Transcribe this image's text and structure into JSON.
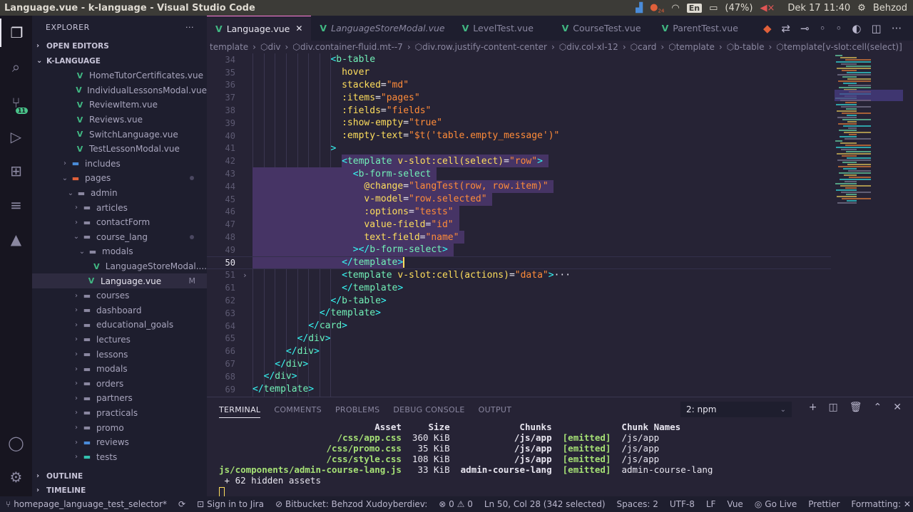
{
  "os": {
    "window_title": "Language.vue - k-language - Visual Studio Code",
    "badge_count": "24",
    "keyboard": "En",
    "battery": "(47%)",
    "datetime": "Dek 17 11:40",
    "user": "Behzod"
  },
  "activity": {
    "scm_badge": "11"
  },
  "sidebar": {
    "title": "EXPLORER",
    "more": "···",
    "open_editors": "OPEN EDITORS",
    "project": "K-LANGUAGE",
    "outline": "OUTLINE",
    "timeline": "TIMELINE",
    "items": [
      {
        "label": "HomeTutorCertificates.vue",
        "type": "vue",
        "indent": 1
      },
      {
        "label": "IndividualLessonsModal.vue",
        "type": "vue",
        "indent": 1
      },
      {
        "label": "ReviewItem.vue",
        "type": "vue",
        "indent": 1
      },
      {
        "label": "Reviews.vue",
        "type": "vue",
        "indent": 1
      },
      {
        "label": "SwitchLanguage.vue",
        "type": "vue",
        "indent": 1
      },
      {
        "label": "TestLessonModal.vue",
        "type": "vue",
        "indent": 1
      },
      {
        "label": "includes",
        "type": "folder-blue",
        "indent": 0
      },
      {
        "label": "pages",
        "type": "folder-red-open",
        "indent": 0
      },
      {
        "label": "admin",
        "type": "folder-open",
        "indent": 1
      },
      {
        "label": "articles",
        "type": "folder",
        "indent": 2
      },
      {
        "label": "contactForm",
        "type": "folder",
        "indent": 2
      },
      {
        "label": "course_lang",
        "type": "folder-open",
        "indent": 2
      },
      {
        "label": "modals",
        "type": "folder-open",
        "indent": 3
      },
      {
        "label": "LanguageStoreModal....",
        "type": "vue",
        "indent": 4
      },
      {
        "label": "Language.vue",
        "type": "vue-sel",
        "indent": 3
      },
      {
        "label": "courses",
        "type": "folder",
        "indent": 2
      },
      {
        "label": "dashboard",
        "type": "folder",
        "indent": 2
      },
      {
        "label": "educational_goals",
        "type": "folder",
        "indent": 2
      },
      {
        "label": "lectures",
        "type": "folder",
        "indent": 2
      },
      {
        "label": "lessons",
        "type": "folder",
        "indent": 2
      },
      {
        "label": "modals",
        "type": "folder",
        "indent": 2
      },
      {
        "label": "orders",
        "type": "folder",
        "indent": 2
      },
      {
        "label": "partners",
        "type": "folder",
        "indent": 2
      },
      {
        "label": "practicals",
        "type": "folder",
        "indent": 2
      },
      {
        "label": "promo",
        "type": "folder",
        "indent": 2
      },
      {
        "label": "reviews",
        "type": "folder-blue",
        "indent": 2
      },
      {
        "label": "tests",
        "type": "folder-teal",
        "indent": 2
      }
    ],
    "modified_mark": "M"
  },
  "tabs": [
    {
      "label": "Language.vue",
      "active": true
    },
    {
      "label": "LanguageStoreModal.vue",
      "italic": true
    },
    {
      "label": "LevelTest.vue"
    },
    {
      "label": "CourseTest.vue"
    },
    {
      "label": "ParentTest.vue"
    }
  ],
  "breadcrumbs": [
    "template",
    "div",
    "div.container-fluid.mt--7",
    "div.row.justify-content-center",
    "div.col-xl-12",
    "card",
    "template",
    "b-table",
    "template[v-slot:cell(select)]"
  ],
  "editor": {
    "lines": [
      {
        "n": "34",
        "indent": 7,
        "html": "<span class='t-ang'>&lt;</span><span class='t-tag'>b-table</span>"
      },
      {
        "n": "35",
        "indent": 8,
        "text": "hover"
      },
      {
        "n": "36",
        "indent": 8,
        "html": "stacked<span class='t-punc'>=</span><span class='t-str'>\"md\"</span>"
      },
      {
        "n": "37",
        "indent": 8,
        "html": ":items<span class='t-punc'>=</span><span class='t-str'>\"pages\"</span>"
      },
      {
        "n": "38",
        "indent": 8,
        "html": ":fields<span class='t-punc'>=</span><span class='t-str'>\"fields\"</span>"
      },
      {
        "n": "39",
        "indent": 8,
        "html": ":show-empty<span class='t-punc'>=</span><span class='t-str'>\"true\"</span>"
      },
      {
        "n": "40",
        "indent": 8,
        "html": ":empty-text<span class='t-punc'>=</span><span class='t-str'>\"$t('table.empty_message')\"</span>"
      },
      {
        "n": "41",
        "indent": 7,
        "html": "<span class='t-ang'>&gt;</span>"
      },
      {
        "n": "42",
        "indent": 8,
        "html": "<span class='t-ang'>&lt;</span><span class='t-tag'>template</span> v-slot:cell(select)<span class='t-punc'>=</span><span class='t-str'>\"row\"</span><span class='t-ang'>&gt;</span>"
      },
      {
        "n": "43",
        "indent": 9,
        "html": "<span class='t-ang'>&lt;</span><span class='t-tag'>b-form-select</span>"
      },
      {
        "n": "44",
        "indent": 10,
        "html": "@change<span class='t-punc'>=</span><span class='t-str'>\"langTest(row, row.item)\"</span>"
      },
      {
        "n": "45",
        "indent": 10,
        "html": "v-model<span class='t-punc'>=</span><span class='t-str'>\"row.selected\"</span>"
      },
      {
        "n": "46",
        "indent": 10,
        "html": ":options<span class='t-punc'>=</span><span class='t-str'>\"tests\"</span>"
      },
      {
        "n": "47",
        "indent": 10,
        "html": "value-field<span class='t-punc'>=</span><span class='t-str'>\"id\"</span>"
      },
      {
        "n": "48",
        "indent": 10,
        "html": "text-field<span class='t-punc'>=</span><span class='t-str'>\"name\"</span>"
      },
      {
        "n": "49",
        "indent": 9,
        "html": "<span class='t-ang'>&gt;&lt;/</span><span class='t-tag'>b-form-select</span><span class='t-ang'>&gt;</span>"
      },
      {
        "n": "50",
        "indent": 8,
        "html": "<span class='t-ang'>&lt;/</span><span class='t-tag'>template</span><span class='t-ang'>&gt;</span>",
        "current": true
      },
      {
        "n": "51",
        "indent": 8,
        "html": "<span class='t-ang'>&lt;</span><span class='t-tag'>template</span> v-slot:cell(actions)<span class='t-punc'>=</span><span class='t-str'>\"data\"</span><span class='t-ang'>&gt;</span><span class='t-punc'>···</span>",
        "folded": true
      },
      {
        "n": "61",
        "indent": 8,
        "html": "<span class='t-ang'>&lt;/</span><span class='t-tag'>template</span><span class='t-ang'>&gt;</span>"
      },
      {
        "n": "62",
        "indent": 7,
        "html": "<span class='t-ang'>&lt;/</span><span class='t-tag'>b-table</span><span class='t-ang'>&gt;</span>"
      },
      {
        "n": "63",
        "indent": 6,
        "html": "<span class='t-ang'>&lt;/</span><span class='t-tag'>template</span><span class='t-ang'>&gt;</span>"
      },
      {
        "n": "64",
        "indent": 5,
        "html": "<span class='t-ang'>&lt;/</span><span class='t-tag'>card</span><span class='t-ang'>&gt;</span>"
      },
      {
        "n": "65",
        "indent": 4,
        "html": "<span class='t-ang'>&lt;/</span><span class='t-tag'>div</span><span class='t-ang'>&gt;</span>"
      },
      {
        "n": "66",
        "indent": 3,
        "html": "<span class='t-ang'>&lt;/</span><span class='t-tag'>div</span><span class='t-ang'>&gt;</span>"
      },
      {
        "n": "67",
        "indent": 2,
        "html": "<span class='t-ang'>&lt;/</span><span class='t-tag'>div</span><span class='t-ang'>&gt;</span>"
      },
      {
        "n": "68",
        "indent": 1,
        "html": "<span class='t-ang'>&lt;/</span><span class='t-tag'>div</span><span class='t-ang'>&gt;</span>"
      },
      {
        "n": "69",
        "indent": 0,
        "html": "<span class='t-ang'>&lt;/</span><span class='t-tag'>template</span><span class='t-ang'>&gt;</span>"
      }
    ]
  },
  "panel": {
    "tabs": [
      "TERMINAL",
      "COMMENTS",
      "PROBLEMS",
      "DEBUG CONSOLE",
      "OUTPUT"
    ],
    "terminal_select": "2: npm",
    "header": {
      "asset": "Asset",
      "size": "Size",
      "chunks": "Chunks",
      "names": "Chunk Names"
    },
    "rows": [
      {
        "asset": "/css/app.css",
        "size": "360 KiB",
        "chunk": "/js/app",
        "status": "[emitted]",
        "name": "/js/app"
      },
      {
        "asset": "/css/promo.css",
        "size": "35 KiB",
        "chunk": "/js/app",
        "status": "[emitted]",
        "name": "/js/app"
      },
      {
        "asset": "/css/style.css",
        "size": "108 KiB",
        "chunk": "/js/app",
        "status": "[emitted]",
        "name": "/js/app"
      },
      {
        "asset": "js/components/admin-course-lang.js",
        "size": "33 KiB",
        "chunk": "admin-course-lang",
        "status": "[emitted]",
        "name": "admin-course-lang"
      }
    ],
    "hidden": " + 62 hidden assets"
  },
  "status": {
    "branch": "homepage_language_test_selector*",
    "jira": "Sign in to Jira",
    "bitbucket": "Bitbucket: Behzod Xudoyberdiev:",
    "problems": "⊗ 0 ⚠ 0",
    "position": "Ln 50, Col 28 (342 selected)",
    "spaces": "Spaces: 2",
    "encoding": "UTF-8",
    "eol": "LF",
    "language": "Vue",
    "golive": "Go Live",
    "prettier": "Prettier",
    "formatting": "Formatting: ✕"
  }
}
